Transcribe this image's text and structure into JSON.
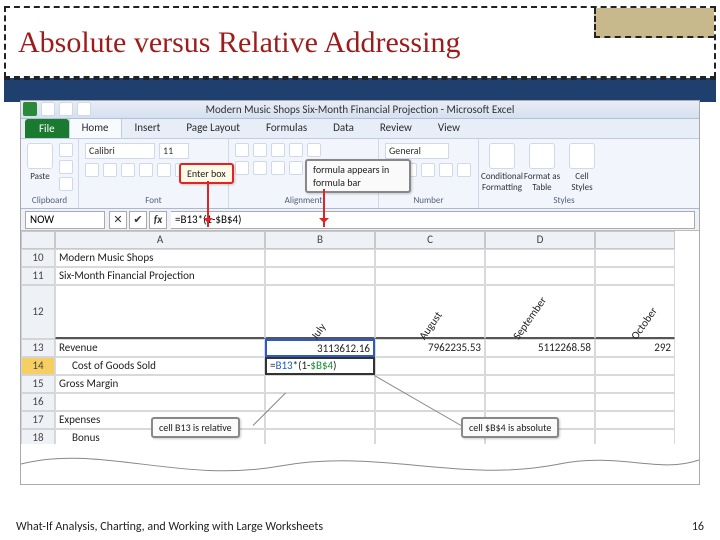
{
  "title": "Absolute versus Relative Addressing",
  "footer": {
    "left": "What-If Analysis, Charting, and Working with Large Worksheets",
    "right": "16"
  },
  "excel": {
    "window_title": "Modern Music Shops Six-Month Financial Projection  -  Microsoft Excel",
    "tabs": {
      "file": "File",
      "home": "Home",
      "insert": "Insert",
      "page_layout": "Page Layout",
      "formulas": "Formulas",
      "data": "Data",
      "review": "Review",
      "view": "View"
    },
    "groups": {
      "clipboard": {
        "label": "Clipboard",
        "paste": "Paste"
      },
      "font": {
        "label": "Font",
        "family": "Calibri",
        "size": "11"
      },
      "alignment": {
        "label": "Alignment"
      },
      "number": {
        "label": "Number",
        "format": "General"
      },
      "styles": {
        "label": "Styles",
        "cond": "Conditional Formatting",
        "table": "Format as Table",
        "cell": "Cell Styles"
      }
    },
    "fx": {
      "namebox": "NOW",
      "cancel": "✕",
      "enter": "✔",
      "fx": "fx",
      "formula": "=B13*(1-$B$4)"
    },
    "callouts": {
      "enter_box": "Enter box",
      "formula_bar": "formula appears in formula bar",
      "relative": "cell B13 is relative",
      "absolute": "cell $B$4 is absolute"
    },
    "cols": [
      "A",
      "B",
      "C",
      "D",
      ""
    ],
    "rows": {
      "r10": {
        "n": "10",
        "a": "Modern Music Shops"
      },
      "r11": {
        "n": "11",
        "a": "Six-Month Financial Projection"
      },
      "r12": {
        "n": "12",
        "months": [
          "July",
          "August",
          "September",
          "October"
        ]
      },
      "r13": {
        "n": "13",
        "a": "Revenue",
        "b": "3113612.16",
        "c": "7962235.53",
        "d": "5112268.58",
        "e": "292"
      },
      "r14": {
        "n": "14",
        "a": "Cost of Goods Sold",
        "b_prefix": "=",
        "b_b13": "B13",
        "b_mid": "*(1-",
        "b_abs": "$B$4",
        "b_suffix": ")"
      },
      "r15": {
        "n": "15",
        "a": "Gross Margin"
      },
      "r16": {
        "n": "16"
      },
      "r17": {
        "n": "17",
        "a": "Expenses"
      },
      "r18": {
        "n": "18",
        "a": "Bonus"
      }
    }
  }
}
